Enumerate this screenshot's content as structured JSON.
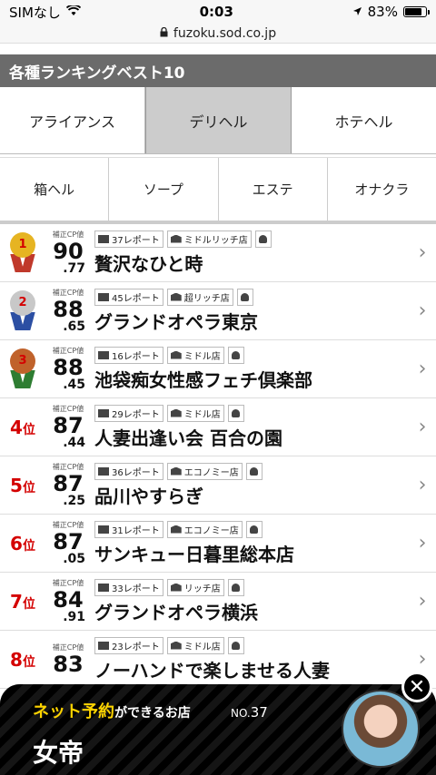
{
  "status": {
    "carrier": "SIMなし",
    "time": "0:03",
    "battery": "83%",
    "battery_level": 0.83,
    "url": "fuzoku.sod.co.jp"
  },
  "section_title": "各種ランキングベスト10",
  "tabs_top": [
    "アライアンス",
    "デリヘル",
    "ホテヘル"
  ],
  "active_tab": "デリヘル",
  "tabs_bottom": [
    "箱ヘル",
    "ソープ",
    "エステ",
    "オナクラ"
  ],
  "rankings": [
    {
      "rank": "1",
      "rank_suffix": "位",
      "cp_label": "補正CP値",
      "score_int": "90",
      "score_dec": ".77",
      "reports": "37レポート",
      "price": "ミドルリッチ店",
      "name": "贅沢なひと時"
    },
    {
      "rank": "2",
      "rank_suffix": "位",
      "cp_label": "補正CP値",
      "score_int": "88",
      "score_dec": ".65",
      "reports": "45レポート",
      "price": "超リッチ店",
      "name": "グランドオペラ東京"
    },
    {
      "rank": "3",
      "rank_suffix": "位",
      "cp_label": "補正CP値",
      "score_int": "88",
      "score_dec": ".45",
      "reports": "16レポート",
      "price": "ミドル店",
      "name": "池袋痴女性感フェチ倶楽部"
    },
    {
      "rank": "4",
      "rank_suffix": "位",
      "cp_label": "補正CP値",
      "score_int": "87",
      "score_dec": ".44",
      "reports": "29レポート",
      "price": "ミドル店",
      "name": "人妻出逢い会 百合の園"
    },
    {
      "rank": "5",
      "rank_suffix": "位",
      "cp_label": "補正CP値",
      "score_int": "87",
      "score_dec": ".25",
      "reports": "36レポート",
      "price": "エコノミー店",
      "name": "品川やすらぎ"
    },
    {
      "rank": "6",
      "rank_suffix": "位",
      "cp_label": "補正CP値",
      "score_int": "87",
      "score_dec": ".05",
      "reports": "31レポート",
      "price": "エコノミー店",
      "name": "サンキュー日暮里総本店"
    },
    {
      "rank": "7",
      "rank_suffix": "位",
      "cp_label": "補正CP値",
      "score_int": "84",
      "score_dec": ".91",
      "reports": "33レポート",
      "price": "リッチ店",
      "name": "グランドオペラ横浜"
    },
    {
      "rank": "8",
      "rank_suffix": "位",
      "cp_label": "補正CP値",
      "score_int": "83",
      "score_dec": "",
      "reports": "23レポート",
      "price": "ミドル店",
      "name": "ノーハンドで楽しませる人妻"
    }
  ],
  "ad": {
    "headline_a": "ネット予約",
    "headline_b": "ができるお店",
    "no_prefix": "NO.",
    "no_value": "37",
    "shop": "女帝",
    "close": "✕"
  },
  "colors": {
    "rank_red": "#d40000",
    "gold": "#e6b422",
    "silver": "#b0b0b0",
    "bronze": "#c0622b",
    "ad_yellow": "#ffd400"
  }
}
